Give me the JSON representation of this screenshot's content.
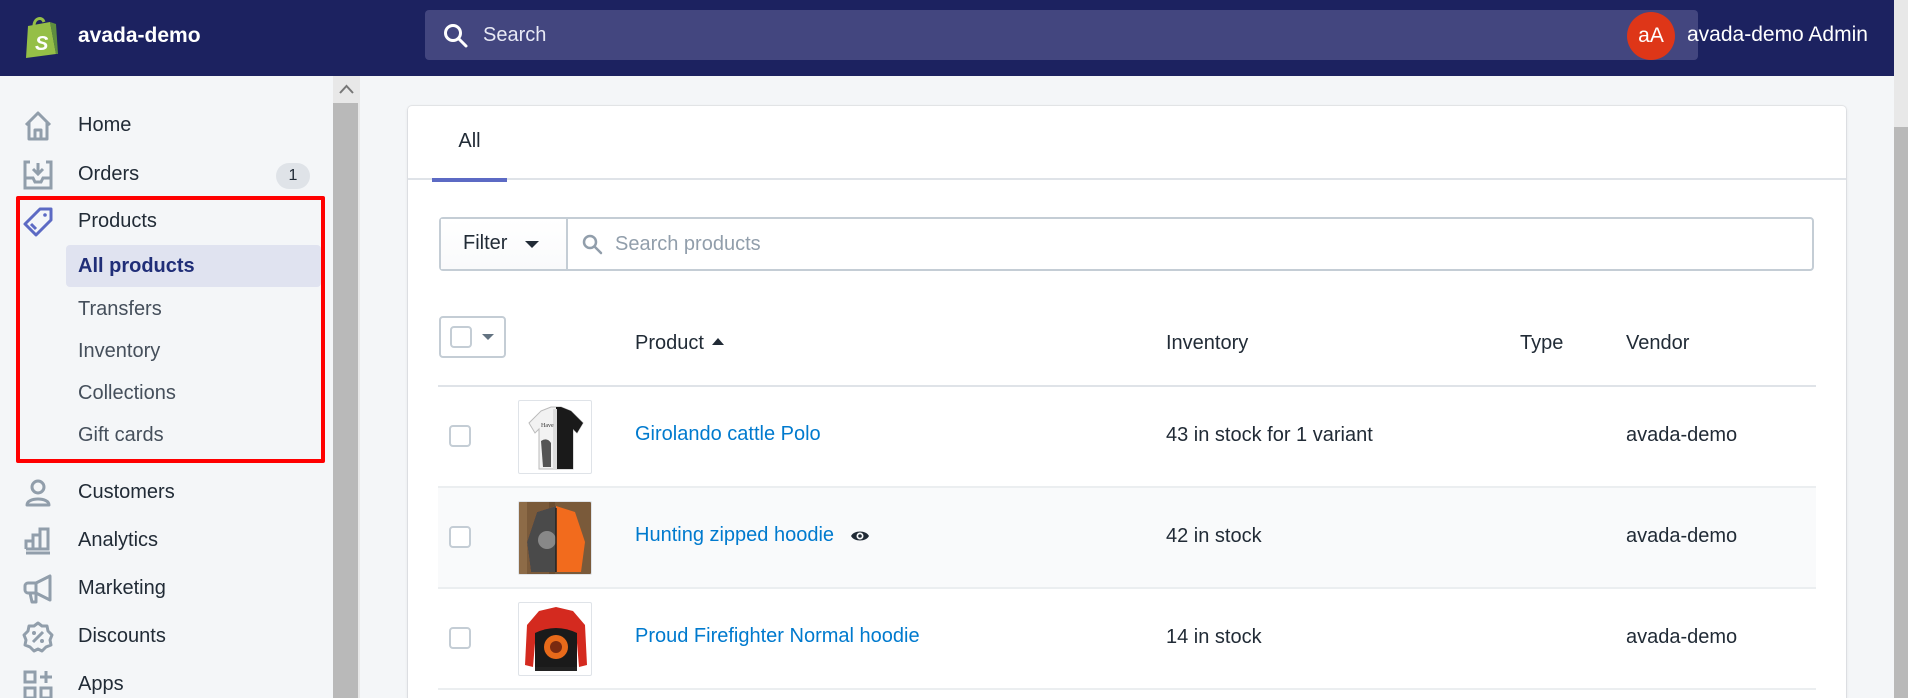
{
  "topbar": {
    "store_name": "avada-demo",
    "search_placeholder": "Search",
    "avatar_initials": "aA",
    "user_name": "avada-demo Admin",
    "bg_color": "#1c2260",
    "avatar_color": "#de3618"
  },
  "sidebar": {
    "items": [
      {
        "label": "Home",
        "icon": "home-icon"
      },
      {
        "label": "Orders",
        "icon": "orders-icon",
        "badge": "1"
      },
      {
        "label": "Products",
        "icon": "tag-icon",
        "active": true
      },
      {
        "label": "Customers",
        "icon": "customer-icon"
      },
      {
        "label": "Analytics",
        "icon": "analytics-icon"
      },
      {
        "label": "Marketing",
        "icon": "megaphone-icon"
      },
      {
        "label": "Discounts",
        "icon": "discount-icon"
      },
      {
        "label": "Apps",
        "icon": "apps-icon"
      }
    ],
    "product_subitems": [
      {
        "label": "All products",
        "active": true
      },
      {
        "label": "Transfers"
      },
      {
        "label": "Inventory"
      },
      {
        "label": "Collections"
      },
      {
        "label": "Gift cards"
      }
    ],
    "highlight_color": "#ff0000"
  },
  "main": {
    "tabs": [
      {
        "label": "All",
        "active": true
      }
    ],
    "filter_label": "Filter",
    "search_placeholder": "Search products",
    "table": {
      "columns": [
        "Product",
        "Inventory",
        "Type",
        "Vendor"
      ],
      "sort": {
        "column": "Product",
        "direction": "ascending"
      },
      "rows": [
        {
          "name": "Girolando cattle Polo",
          "inventory": "43 in stock for 1 variant",
          "type": "",
          "vendor": "avada-demo",
          "hidden_icon": false
        },
        {
          "name": "Hunting zipped hoodie",
          "inventory": "42 in stock",
          "type": "",
          "vendor": "avada-demo",
          "hidden_icon": true
        },
        {
          "name": "Proud Firefighter Normal hoodie",
          "inventory": "14 in stock",
          "type": "",
          "vendor": "avada-demo",
          "hidden_icon": false
        }
      ]
    },
    "link_color": "#007ace",
    "accent_color": "#5c6ac4"
  }
}
